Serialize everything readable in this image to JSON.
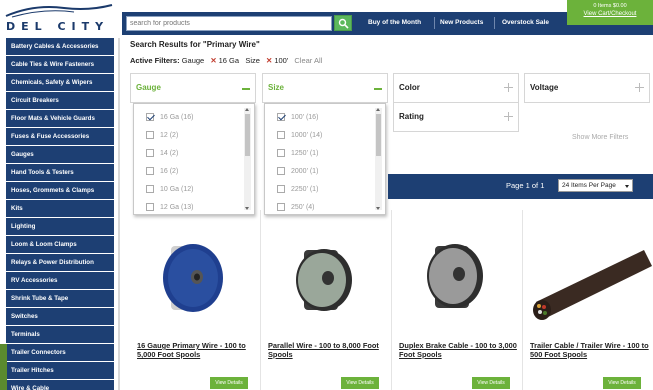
{
  "header": {
    "logo_text": "DEL CITY",
    "search_placeholder": "search for products",
    "nav": [
      "Buy of the Month",
      "New Products",
      "Overstock Sale"
    ],
    "cart_line1": "0 Items  $0.00",
    "cart_line2": "View Cart/Checkout"
  },
  "sidebar": {
    "items": [
      "Battery Cables & Accessories",
      "Cable Ties & Wire Fasteners",
      "Chemicals, Safety & Wipers",
      "Circuit Breakers",
      "Floor Mats & Vehicle Guards",
      "Fuses & Fuse Accessories",
      "Gauges",
      "Hand Tools & Testers",
      "Hoses, Grommets & Clamps",
      "Kits",
      "Lighting",
      "Loom & Loom Clamps",
      "Relays & Power Distribution",
      "RV Accessories",
      "Shrink Tube & Tape",
      "Switches",
      "Terminals",
      "Trailer Connectors",
      "Trailer Hitches",
      "Wire & Cable"
    ]
  },
  "main": {
    "results_title": "Search Results for \"Primary Wire\"",
    "active_filters_label": "Active Filters:",
    "active_filters": [
      {
        "name": "Gauge",
        "value": "16 Ga"
      },
      {
        "name": "Size",
        "value": "100'"
      }
    ],
    "clear_all": "Clear All",
    "filter_boxes": {
      "gauge": "Gauge",
      "size": "Size",
      "color": "Color",
      "voltage": "Voltage",
      "rating": "Rating"
    },
    "gauge_options": [
      {
        "label": "16 Ga (16)",
        "checked": true
      },
      {
        "label": "12 (2)",
        "checked": false
      },
      {
        "label": "14 (2)",
        "checked": false
      },
      {
        "label": "16 (2)",
        "checked": false
      },
      {
        "label": "10 Ga (12)",
        "checked": false
      },
      {
        "label": "12 Ga (13)",
        "checked": false
      }
    ],
    "size_options": [
      {
        "label": "100' (16)",
        "checked": true
      },
      {
        "label": "1000' (14)",
        "checked": false
      },
      {
        "label": "1250' (1)",
        "checked": false
      },
      {
        "label": "2000' (1)",
        "checked": false
      },
      {
        "label": "2250' (1)",
        "checked": false
      },
      {
        "label": "250' (4)",
        "checked": false
      }
    ],
    "show_more": "Show More Filters",
    "pager_text": "Page 1 of 1",
    "per_page": "24 Items Per Page"
  },
  "products": [
    {
      "title": "16 Gauge Primary Wire - 100 to 5,000 Foot Spools",
      "button": "View Details",
      "color": "#2a4fa0"
    },
    {
      "title": "Parallel Wire - 100 to 8,000 Foot Spools",
      "button": "View Details",
      "color": "#9aa79a"
    },
    {
      "title": "Duplex Brake Cable - 100 to 3,000 Foot Spools",
      "button": "View Details",
      "color": "#9a9a9a"
    },
    {
      "title": "Trailer Cable / Trailer Wire - 100 to 500 Foot Spools",
      "button": "View Details",
      "color": "#3a2a22"
    }
  ],
  "colors": {
    "navy": "#1d3f73",
    "green": "#6cb23b",
    "remove_x": "#c0392b"
  }
}
